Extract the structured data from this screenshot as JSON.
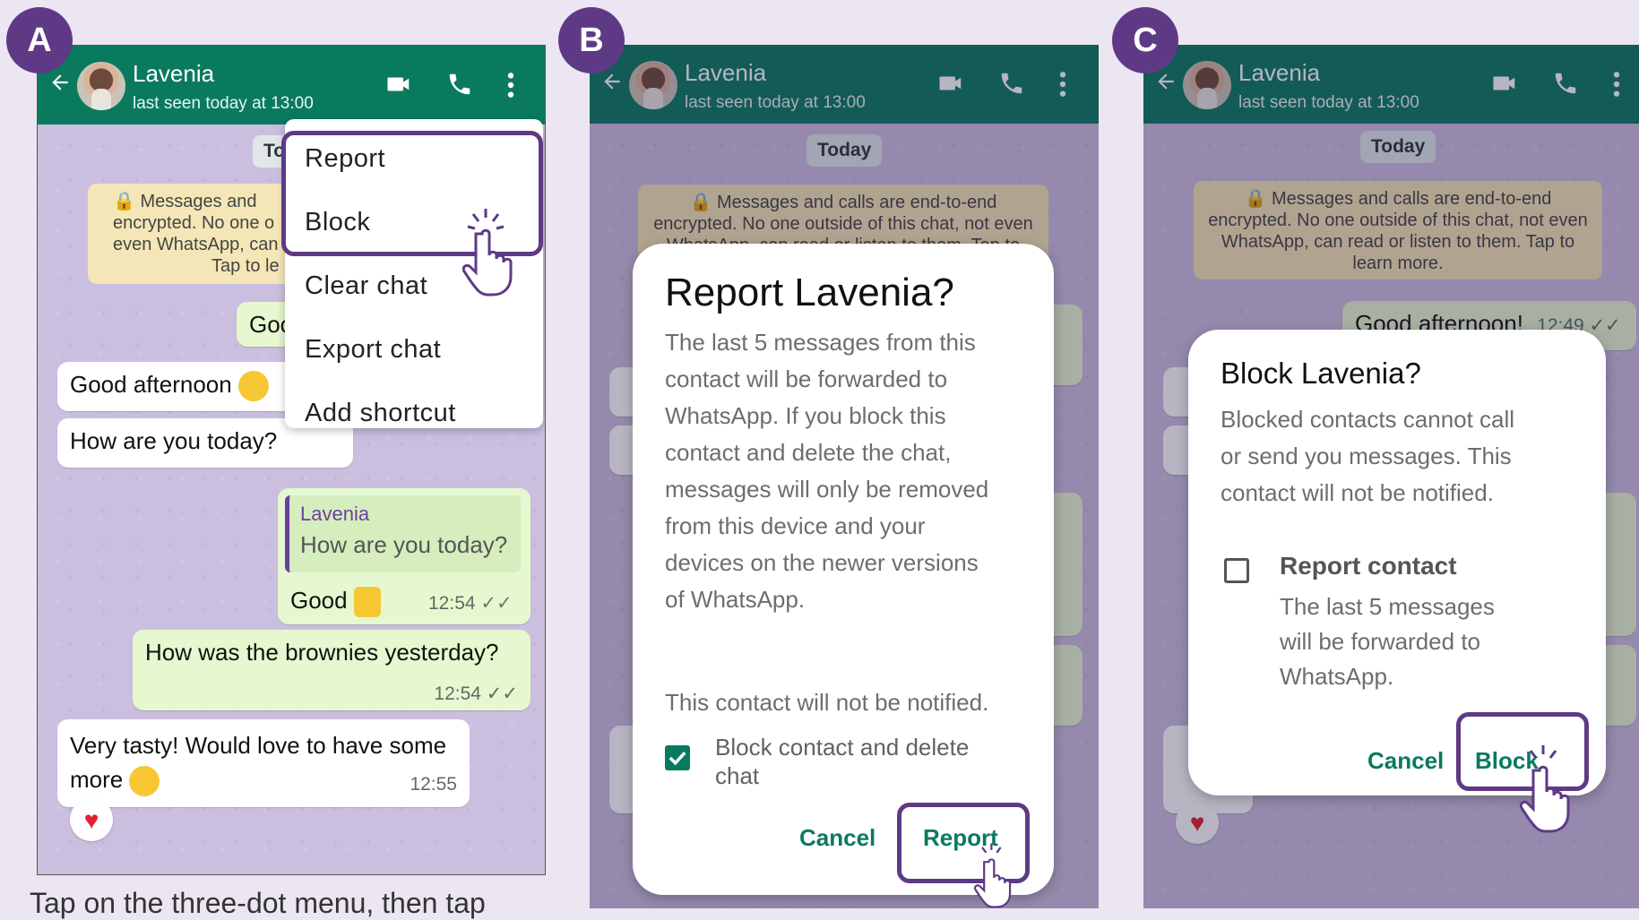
{
  "labels": {
    "a": "A",
    "b": "B",
    "c": "C"
  },
  "chat": {
    "contact_name": "Lavenia",
    "last_seen": "last seen today at 13:00",
    "today_chip": "Today",
    "encryption_notice": "🔒 Messages and calls are end-to-end encrypted. No one outside of this chat, not even WhatsApp, can read or listen to them. Tap to learn more.",
    "encryption_a1": "🔒 Messages and",
    "encryption_a2": "encrypted. No one o",
    "encryption_a3": "even WhatsApp, can",
    "encryption_a4": "Tap to le",
    "chip_partial": "To",
    "messages": [
      {
        "text": "Good afternoon!",
        "partial": "Goo",
        "time": "12:49"
      },
      {
        "text": "Good afternoon"
      },
      {
        "text": "How are you today?"
      },
      {
        "quote_name": "Lavenia",
        "quote_text": "How are you today?",
        "text": "Good",
        "time": "12:54"
      },
      {
        "text": "How was the brownies yesterday?",
        "time": "12:54"
      },
      {
        "text": "Very tasty! Would love to have some",
        "text2": "more",
        "time": "12:55"
      }
    ]
  },
  "menu": {
    "items": [
      "Report",
      "Block",
      "Clear chat",
      "Export chat",
      "Add shortcut"
    ]
  },
  "report_dialog": {
    "title": "Report Lavenia?",
    "body": [
      "The last 5 messages from this",
      "contact will be forwarded to",
      "WhatsApp. If you block this",
      "contact and delete the chat,",
      "messages will only be removed",
      "from this device and your",
      "devices on the newer versions",
      "of WhatsApp."
    ],
    "notice": "This contact will not be notified.",
    "checkbox_label_1": "Block contact and delete",
    "checkbox_label_2": "chat",
    "checkbox_checked": true,
    "cancel": "Cancel",
    "confirm": "Report"
  },
  "block_dialog": {
    "title": "Block Lavenia?",
    "body": [
      "Blocked contacts cannot call",
      "or send you messages. This",
      "contact will not be notified."
    ],
    "checkbox_title": "Report contact",
    "checkbox_body": [
      "The last 5 messages",
      "will be forwarded to",
      "WhatsApp."
    ],
    "checkbox_checked": false,
    "cancel": "Cancel",
    "confirm": "Block"
  },
  "caption": "Tap on the three-dot menu, then tap",
  "colors": {
    "header": "#0a7a5e",
    "accent": "#5e3a86",
    "outgoing": "#e6f8cf",
    "wallpaper": "#cbbfe0"
  }
}
